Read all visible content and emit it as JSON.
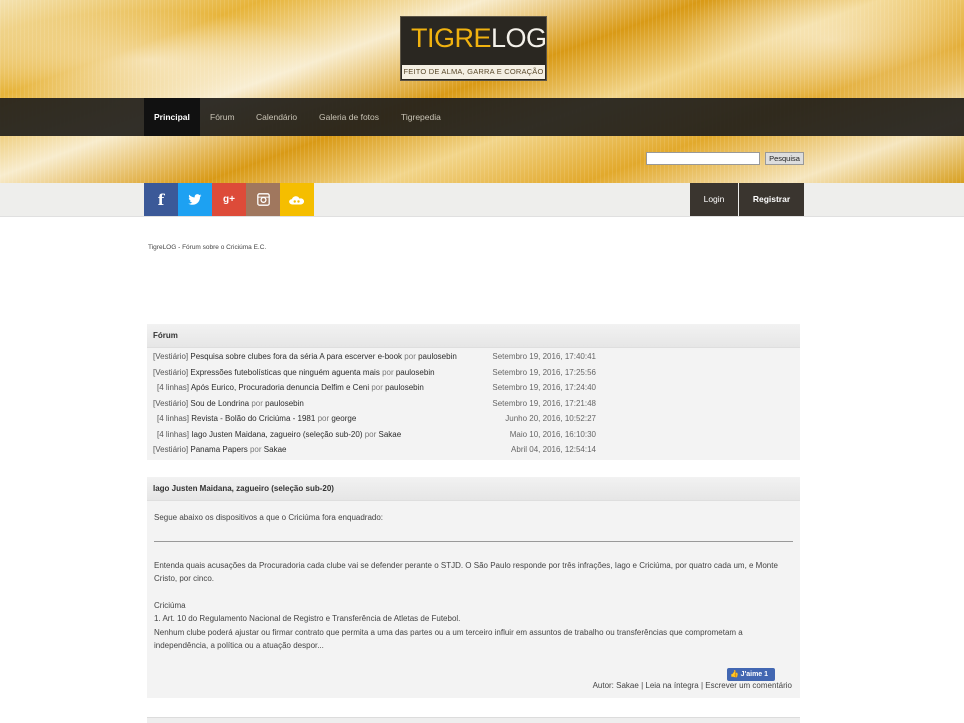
{
  "header": {
    "logo_part1": "TIGRE",
    "logo_part2": "LOG",
    "tagline": "FEITO DE ALMA, GARRA E CORAÇÃO"
  },
  "nav": {
    "items": [
      "Principal",
      "Fórum",
      "Calendário",
      "Galeria de fotos",
      "Tigrepedia"
    ],
    "active": "Principal"
  },
  "search": {
    "value": "",
    "button_label": "Pesquisa"
  },
  "social": {
    "items": [
      {
        "icon": "facebook-icon",
        "glyph": "f",
        "color": "#3b5998"
      },
      {
        "icon": "twitter-icon",
        "glyph": "🐦",
        "color": "#1da1f2"
      },
      {
        "icon": "google-plus-icon",
        "glyph": "g+",
        "color": "#dd4b39"
      },
      {
        "icon": "instagram-icon",
        "glyph": "◙",
        "color": "#a0775e"
      },
      {
        "icon": "flickr-icon",
        "glyph": "☁",
        "color": "#f5be00"
      }
    ]
  },
  "account": {
    "login_label": "Login",
    "register_label": "Registrar"
  },
  "breadcrumb": "TigreLOG - Fórum sobre o Criciúma E.C.",
  "forum": {
    "title": "Fórum",
    "posts": [
      {
        "tag": "[Vestiário]",
        "title": "Pesquisa sobre clubes fora da séria A para escerver e-book",
        "por": "por",
        "author": "paulosebin",
        "date": "Setembro 19, 2016, 17:40:41"
      },
      {
        "tag": "[Vestiário]",
        "title": "Expressões futebolísticas que ninguém aguenta mais",
        "por": "por",
        "author": "paulosebin",
        "date": "Setembro 19, 2016, 17:25:56"
      },
      {
        "tag": "[4 linhas]",
        "title": "Após Eurico, Procuradoria denuncia Delfim e Ceni",
        "por": "por",
        "author": "paulosebin",
        "date": "Setembro 19, 2016, 17:24:40"
      },
      {
        "tag": "[Vestiário]",
        "title": "Sou de Londrina",
        "por": "por",
        "author": "paulosebin",
        "date": "Setembro 19, 2016, 17:21:48"
      },
      {
        "tag": "[4 linhas]",
        "title": "Revista - Bolão do Criciúma - 1981",
        "por": "por",
        "author": "george",
        "date": "Junho 20, 2016, 10:52:27"
      },
      {
        "tag": "[4 linhas]",
        "title": "Iago Justen Maidana, zagueiro (seleção sub-20)",
        "por": "por",
        "author": "Sakae",
        "date": "Maio 10, 2016, 16:10:30"
      },
      {
        "tag": "[Vestiário]",
        "title": "Panama Papers",
        "por": "por",
        "author": "Sakae",
        "date": "Abril 04, 2016, 12:54:14"
      }
    ]
  },
  "article": {
    "title": "Iago Justen Maidana, zagueiro (seleção sub-20)",
    "intro": "Segue abaixo os dispositivos a que o Criciúma fora enquadrado:",
    "paragraph1": "Entenda quais acusações da Procuradoria cada clube vai se defender perante o STJD. O São Paulo responde por três infrações, Iago e Criciúma, por quatro cada um, e Monte Cristo, por cinco.",
    "club": "Criciúma",
    "rule": "1. Art. 10 do Regulamento Nacional de Registro e Transferência de Atletas de Futebol.",
    "paragraph2": "Nenhum clube poderá ajustar ou firmar contrato que permita a uma das partes ou a um terceiro influir em assuntos de trabalho ou transferências que comprometam a independência, a política ou a atuação despor...",
    "like_label": "J'aime 1",
    "author_prefix": "Autor:",
    "author": "Sakae",
    "read_more": "Leia na íntegra",
    "comment": "Escrever um comentário",
    "separator": "|"
  }
}
